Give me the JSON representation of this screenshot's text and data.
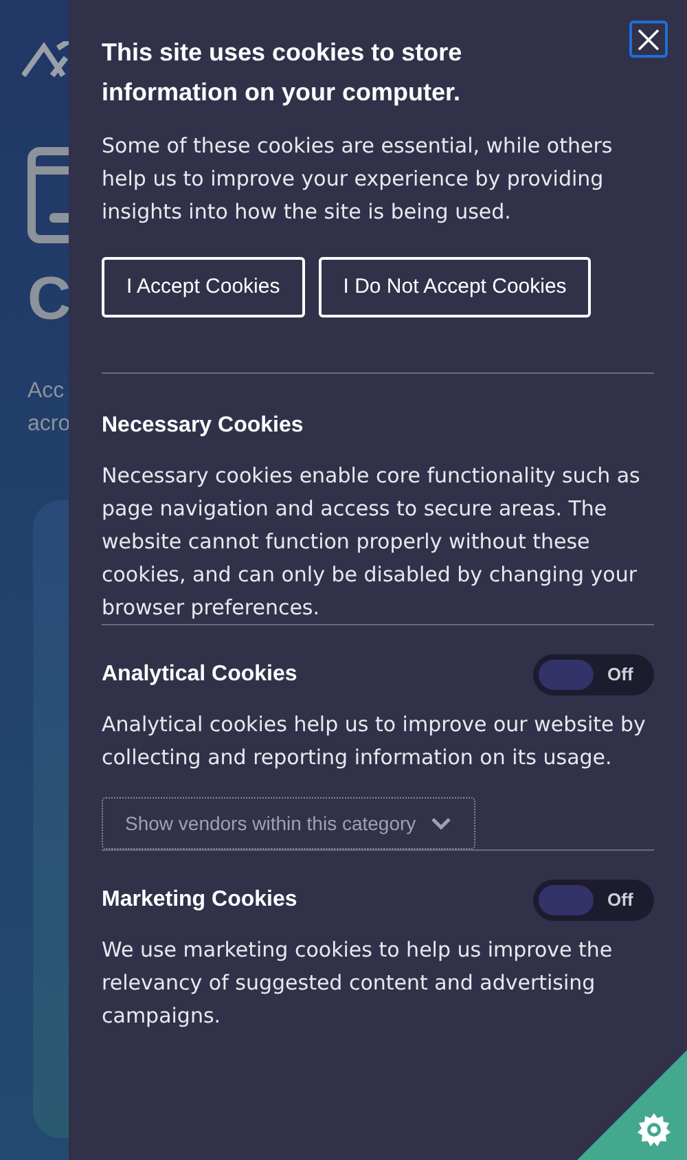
{
  "background_page": {
    "texts": [
      "C",
      "Acc",
      "acro"
    ]
  },
  "dialog": {
    "title": "This site uses cookies to store information on your computer.",
    "intro": "Some of these cookies are essential, while others help us to improve your experience by providing insights into how the site is being used.",
    "buttons": [
      "I Accept Cookies",
      "I Do Not Accept Cookies"
    ]
  },
  "sections": [
    {
      "title": "Necessary Cookies",
      "description": "Necessary cookies enable core functionality such as page navigation and access to secure areas. The website cannot function properly without these cookies, and can only be disabled by changing your browser preferences."
    },
    {
      "title": "Analytical Cookies",
      "toggle": {
        "on": false,
        "label": "Off"
      },
      "description": "Analytical cookies help us to improve our website by collecting and reporting information on its usage.",
      "vendors_button": "Show vendors within this category"
    },
    {
      "title": "Marketing Cookies",
      "toggle": {
        "on": false,
        "label": "Off"
      },
      "description": "We use marketing cookies to help us improve the relevancy of suggested content and advertising campaigns."
    }
  ]
}
